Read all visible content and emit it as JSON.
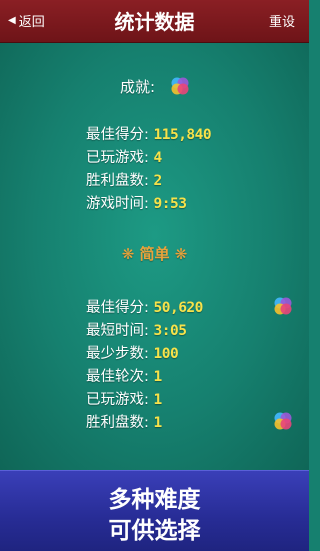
{
  "header": {
    "back_label": "返回",
    "title": "统计数据",
    "reset_label": "重设"
  },
  "achievements": {
    "label": "成就:"
  },
  "overall": [
    {
      "label": "最佳得分:",
      "value": "115,840"
    },
    {
      "label": "已玩游戏:",
      "value": "4"
    },
    {
      "label": "胜利盘数:",
      "value": "2"
    },
    {
      "label": "游戏时间:",
      "value": "9:53"
    }
  ],
  "easy": {
    "title": "❋ 简单 ❋",
    "rows": [
      {
        "label": "最佳得分:",
        "value": "50,620"
      },
      {
        "label": "最短时间:",
        "value": "3:05"
      },
      {
        "label": "最少步数:",
        "value": "100"
      },
      {
        "label": "最佳轮次:",
        "value": "1"
      },
      {
        "label": "已玩游戏:",
        "value": "1"
      },
      {
        "label": "胜利盘数:",
        "value": "1"
      }
    ]
  },
  "banner": {
    "line1": "多种难度",
    "line2": "可供选择"
  },
  "colors": {
    "felt": "#16806f",
    "header": "#7a181c",
    "value": "#f7e24a",
    "section": "#e9a23a",
    "banner": "#2c319e"
  }
}
